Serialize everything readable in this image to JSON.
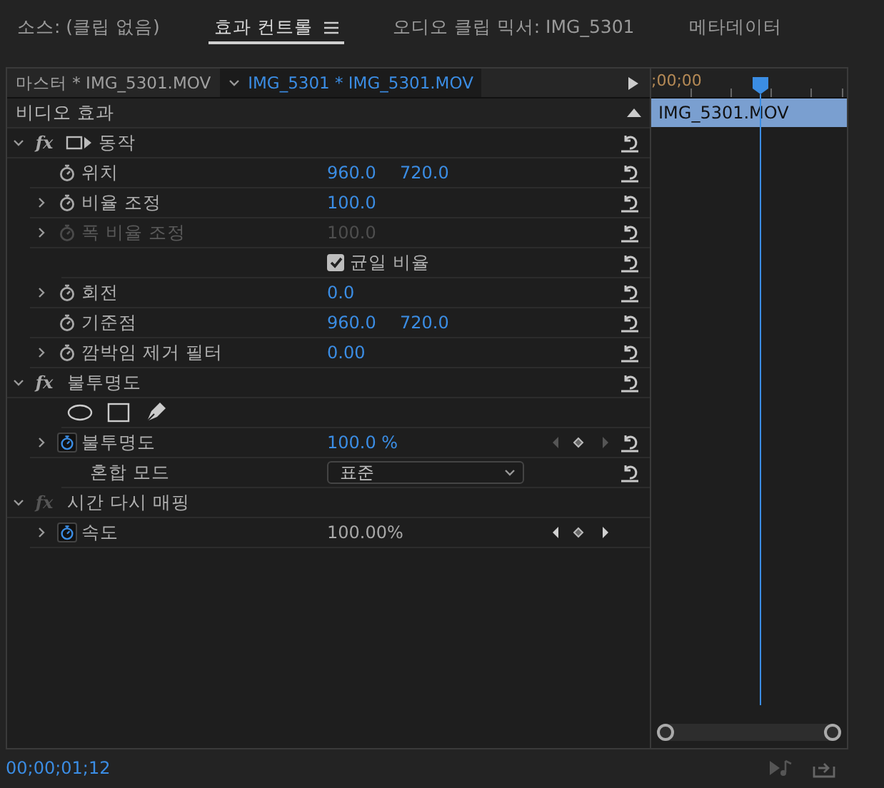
{
  "tabs": [
    {
      "label": "소스: (클립 없음)",
      "selected": false
    },
    {
      "label": "효과 컨트롤",
      "selected": true
    },
    {
      "label": "오디오 클립 믹서: IMG_5301",
      "selected": false
    },
    {
      "label": "메타데이터",
      "selected": false
    }
  ],
  "clip_tabs": [
    {
      "label": "마스터 * IMG_5301.MOV",
      "selected": false
    },
    {
      "label": "IMG_5301 * IMG_5301.MOV",
      "selected": true
    }
  ],
  "section_title": "비디오 효과",
  "effects": [
    {
      "name": "동작",
      "badge": "fx",
      "expanded": true,
      "enabled": true,
      "motion_handle": true,
      "properties": [
        {
          "kind": "param",
          "name": "위치",
          "expandable": false,
          "disabled": false,
          "animated": false,
          "values": [
            "960.0",
            "720.0"
          ],
          "editable": true
        },
        {
          "kind": "param",
          "name": "비율 조정",
          "expandable": true,
          "disabled": false,
          "animated": false,
          "values": [
            "100.0"
          ],
          "editable": true
        },
        {
          "kind": "param",
          "name": "폭 비율 조정",
          "expandable": true,
          "disabled": true,
          "animated": false,
          "values": [
            "100.0"
          ]
        },
        {
          "kind": "checkbox",
          "label": "균일 비율",
          "checked": true
        },
        {
          "kind": "param",
          "name": "회전",
          "expandable": true,
          "disabled": false,
          "animated": false,
          "values": [
            "0.0"
          ],
          "editable": true
        },
        {
          "kind": "param",
          "name": "기준점",
          "expandable": false,
          "disabled": false,
          "animated": false,
          "values": [
            "960.0",
            "720.0"
          ],
          "editable": true
        },
        {
          "kind": "param",
          "name": "깜박임 제거 필터",
          "expandable": true,
          "disabled": false,
          "animated": false,
          "values": [
            "0.00"
          ],
          "editable": true
        }
      ]
    },
    {
      "name": "불투명도",
      "badge": "fx",
      "expanded": true,
      "enabled": true,
      "motion_handle": false,
      "properties": [
        {
          "kind": "masks"
        },
        {
          "kind": "param",
          "name": "불투명도",
          "expandable": true,
          "disabled": false,
          "animated": true,
          "values": [
            "100.0 %"
          ],
          "editable": true,
          "keyframes": {
            "active": false
          }
        },
        {
          "kind": "dropdown",
          "name": "혼합 모드",
          "value": "표준"
        }
      ]
    },
    {
      "name": "시간 다시 매핑",
      "badge": "fx",
      "expanded": true,
      "enabled": false,
      "motion_handle": false,
      "reset": false,
      "properties": [
        {
          "kind": "param",
          "name": "속도",
          "expandable": true,
          "disabled": false,
          "animated": true,
          "values": [
            "100.00%"
          ],
          "editable": false,
          "keyframes": {
            "active": true
          },
          "reset": false
        }
      ]
    }
  ],
  "timeline": {
    "timecode": ";00;00",
    "clip": "IMG_5301.MOV"
  },
  "current_time": "00;00;01;12"
}
